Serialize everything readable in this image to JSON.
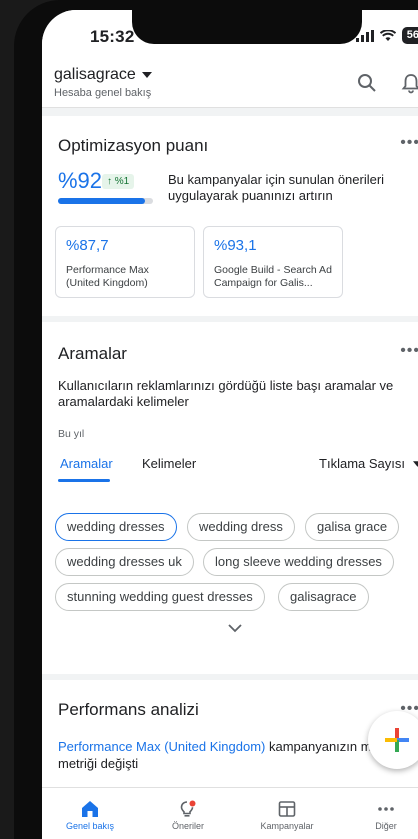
{
  "status": {
    "time": "15:32",
    "battery": "56"
  },
  "header": {
    "account": "galisagrace",
    "subtitle": "Hesaba genel bakış"
  },
  "optimization": {
    "title": "Optimizasyon puanı",
    "score": "%92",
    "delta": "↑ %1",
    "progress": 0.92,
    "description": "Bu kampanyalar için sunulan önerileri uygulayarak puanınızı artırın",
    "campaigns": [
      {
        "score": "%87,7",
        "name": "Performance Max (United Kingdom)"
      },
      {
        "score": "%93,1",
        "name": "Google Build - Search Ad Campaign for Galis..."
      }
    ]
  },
  "searches": {
    "title": "Aramalar",
    "description": "Kullanıcıların reklamlarınızı gördüğü liste başı aramalar ve aramalardaki kelimeler",
    "period": "Bu yıl",
    "tabs": [
      "Aramalar",
      "Kelimeler"
    ],
    "sort": "Tıklama Sayısı",
    "chips": [
      "wedding dresses",
      "wedding dress",
      "galisa grace",
      "wedding dresses uk",
      "long sleeve wedding dresses",
      "stunning wedding guest dresses",
      "galisagrace"
    ]
  },
  "performance": {
    "title": "Performans analizi",
    "link": "Performance Max (United Kingdom)",
    "text_after": " kampanyanızın ma",
    "text_line2": "metriği değişti"
  },
  "nav": [
    {
      "label": "Genel bakış",
      "icon": "home-icon",
      "active": true
    },
    {
      "label": "Öneriler",
      "icon": "lightbulb-icon",
      "active": false
    },
    {
      "label": "Kampanyalar",
      "icon": "campaigns-icon",
      "active": false
    },
    {
      "label": "Diğer",
      "icon": "more-icon",
      "active": false
    }
  ],
  "colors": {
    "accent": "#1a73e8",
    "positive": "#137333",
    "positive_bg": "#e6f4ea"
  }
}
